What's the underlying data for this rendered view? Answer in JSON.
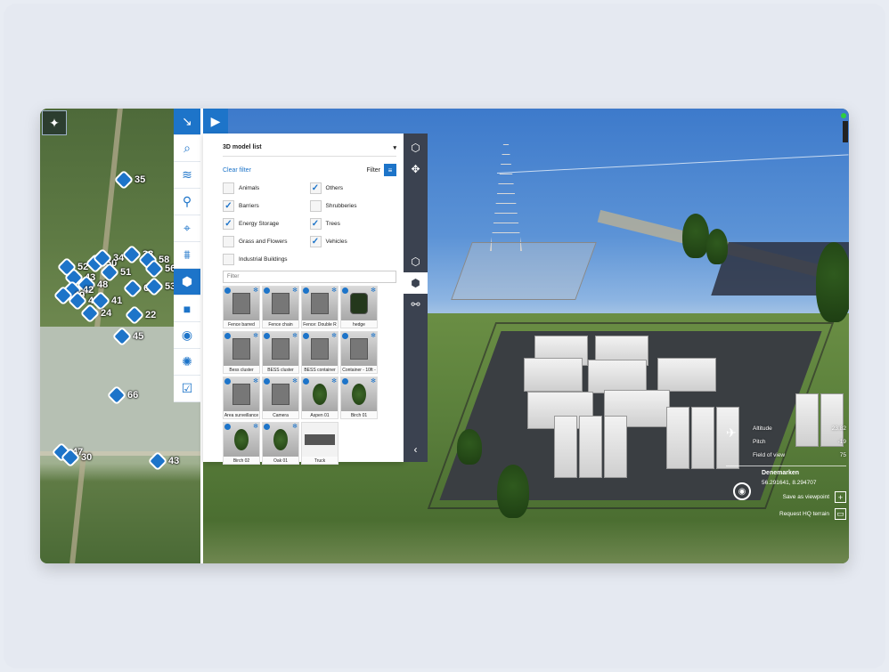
{
  "panel": {
    "title": "3D model list",
    "clear_filter": "Clear filter",
    "filter_label": "Filter",
    "search_placeholder": "Filter",
    "categories": [
      {
        "label": "Animals",
        "checked": false
      },
      {
        "label": "Others",
        "checked": true
      },
      {
        "label": "Barriers",
        "checked": true
      },
      {
        "label": "Shrubberies",
        "checked": false
      },
      {
        "label": "Energy Storage",
        "checked": true
      },
      {
        "label": "Trees",
        "checked": true
      },
      {
        "label": "Grass and Flowers",
        "checked": false
      },
      {
        "label": "Vehicles",
        "checked": true
      },
      {
        "label": "Industrial Buildings",
        "checked": false
      }
    ],
    "models": [
      {
        "label": "Fence barred"
      },
      {
        "label": "Fence chain"
      },
      {
        "label": "Fence: Double R"
      },
      {
        "label": "hedge"
      },
      {
        "label": "Bess cluster"
      },
      {
        "label": "BESS cluster"
      },
      {
        "label": "BESS container"
      },
      {
        "label": "Container - 10ft -"
      },
      {
        "label": "Area surveillance"
      },
      {
        "label": "Camera"
      },
      {
        "label": "Aspen 01"
      },
      {
        "label": "Birch 01"
      },
      {
        "label": "Birch 02"
      },
      {
        "label": "Oak 01"
      },
      {
        "label": "Truck"
      }
    ]
  },
  "map_pins": [
    {
      "label": "35"
    },
    {
      "label": "52"
    },
    {
      "label": "50"
    },
    {
      "label": "34"
    },
    {
      "label": "33"
    },
    {
      "label": "58"
    },
    {
      "label": "56"
    },
    {
      "label": "51"
    },
    {
      "label": "43"
    },
    {
      "label": "48"
    },
    {
      "label": "42"
    },
    {
      "label": "49"
    },
    {
      "label": "47"
    },
    {
      "label": "41"
    },
    {
      "label": "24"
    },
    {
      "label": "63"
    },
    {
      "label": "53"
    },
    {
      "label": "22"
    },
    {
      "label": "45"
    },
    {
      "label": "66"
    },
    {
      "label": "47"
    },
    {
      "label": "30"
    },
    {
      "label": "43"
    }
  ],
  "viewpoint": {
    "altitude_label": "Altitude",
    "altitude_value": "23.82",
    "pitch_label": "Pitch",
    "pitch_value": "-19",
    "fov_label": "Field of view",
    "fov_value": "75",
    "place": "Denemarken",
    "coords": "56.291641, 8.294707",
    "save_label": "Save as viewpoint",
    "request_label": "Request HQ terrain"
  },
  "colors": {
    "accent": "#1d74c9",
    "dark_toolbar": "#3b4250"
  }
}
